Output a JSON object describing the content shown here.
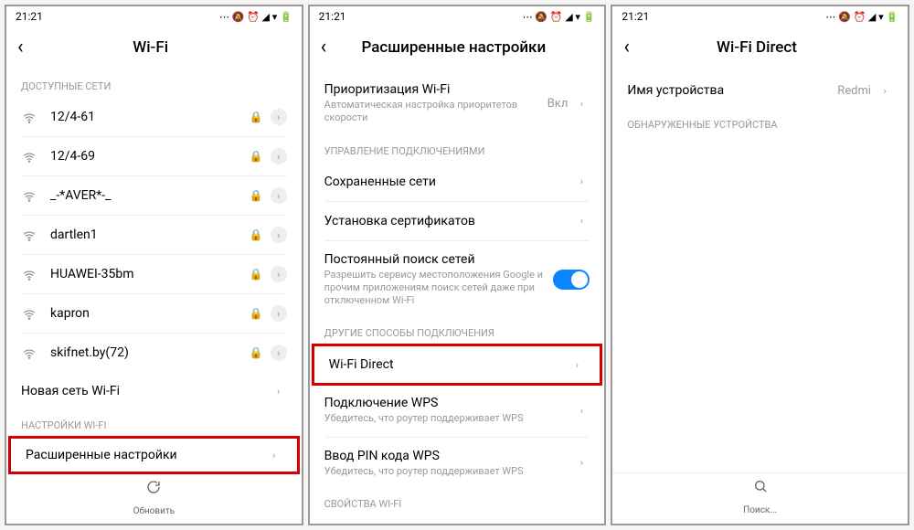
{
  "status": {
    "time": "21:21"
  },
  "screen1": {
    "title": "Wi-Fi",
    "available_header": "ДОСТУПНЫЕ СЕТИ",
    "networks": [
      {
        "name": "12/4-61",
        "locked": true
      },
      {
        "name": "12/4-69",
        "locked": true
      },
      {
        "name": "_-*AVER*-_",
        "locked": true
      },
      {
        "name": "dartlen1",
        "locked": true
      },
      {
        "name": "HUAWEI-35bm",
        "locked": true
      },
      {
        "name": "kapron",
        "locked": true
      },
      {
        "name": "skifnet.by(72)",
        "locked": true
      }
    ],
    "new_network": "Новая сеть Wi-Fi",
    "settings_header": "НАСТРОЙКИ WI-FI",
    "advanced": "Расширенные настройки",
    "refresh": "Обновить"
  },
  "screen2": {
    "title": "Расширенные настройки",
    "priority": {
      "title": "Приоритизация Wi-Fi",
      "sub": "Автоматическая настройка приоритетов скорости",
      "value": "Вкл"
    },
    "connections_header": "УПРАВЛЕНИЕ ПОДКЛЮЧЕНИЯМИ",
    "saved": "Сохраненные сети",
    "certs": "Установка сертификатов",
    "scan": {
      "title": "Постоянный поиск сетей",
      "sub": "Разрешить сервису местоположения Google и прочим приложениям поиск сетей даже при отключенном Wi-Fi"
    },
    "other_header": "ДРУГИЕ СПОСОБЫ ПОДКЛЮЧЕНИЯ",
    "wifi_direct": "Wi-Fi Direct",
    "wps": {
      "title": "Подключение WPS",
      "sub": "Убедитесь, что роутер поддерживает WPS"
    },
    "wps_pin": {
      "title": "Ввод PIN кода WPS",
      "sub": "Убедитесь, что роутер поддерживает WPS"
    },
    "properties_header": "СВОЙСТВА WI-FI"
  },
  "screen3": {
    "title": "Wi-Fi Direct",
    "device_name_label": "Имя устройства",
    "device_name_value": "Redmi",
    "discovered_header": "ОБНАРУЖЕННЫЕ УСТРОЙСТВА",
    "search": "Поиск..."
  }
}
